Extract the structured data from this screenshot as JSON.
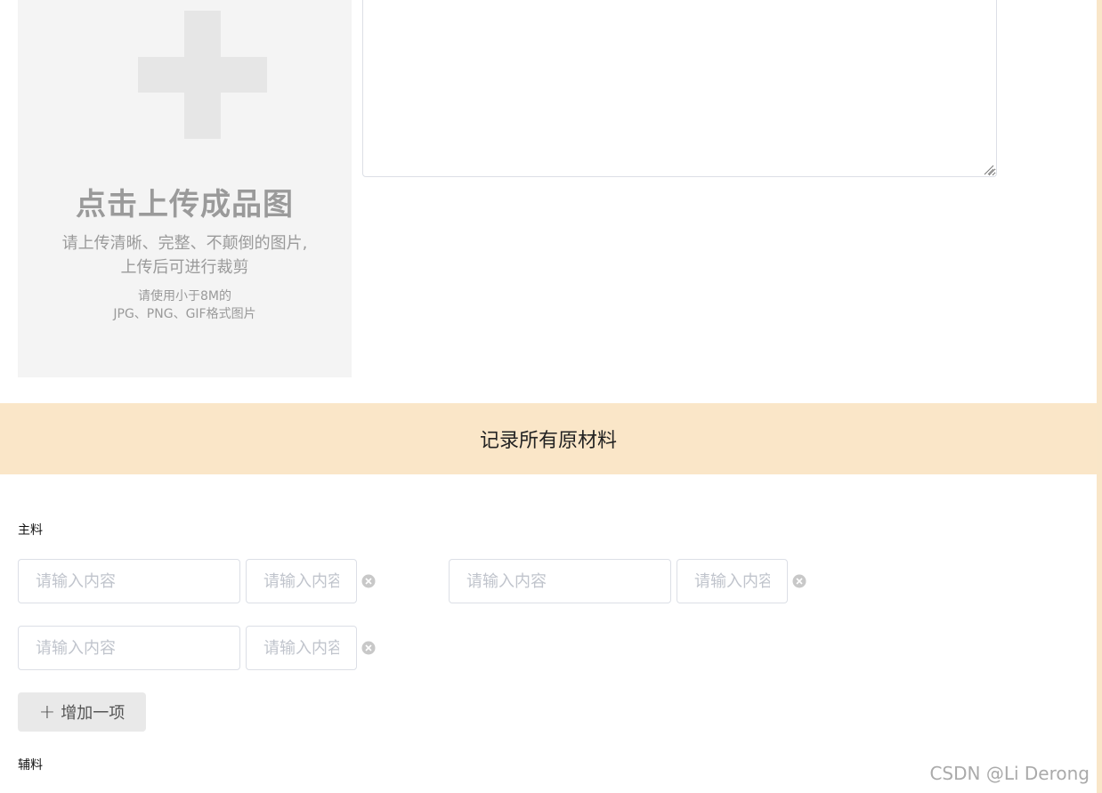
{
  "upload": {
    "title": "点击上传成品图",
    "hint_line1": "请上传清晰、完整、不颠倒的图片,",
    "hint_line2": "上传后可进行裁剪",
    "spec_line1": "请使用小于8M的",
    "spec_line2": "JPG、PNG、GIF格式图片"
  },
  "banner": {
    "title": "记录所有原材料"
  },
  "main_ingredients": {
    "label": "主料",
    "rows": [
      {
        "name_placeholder": "请输入内容",
        "amount_placeholder": "请输入内容"
      },
      {
        "name_placeholder": "请输入内容",
        "amount_placeholder": "请输入内容"
      },
      {
        "name_placeholder": "请输入内容",
        "amount_placeholder": "请输入内容"
      }
    ],
    "add_label": "增加一项"
  },
  "secondary_ingredients": {
    "label": "辅料"
  },
  "watermark": "CSDN @Li Derong",
  "colors": {
    "banner": "#fae6c8",
    "upload_bg": "#f4f4f4",
    "plus": "#e6e6e6",
    "text_muted": "#9a9a9a"
  }
}
